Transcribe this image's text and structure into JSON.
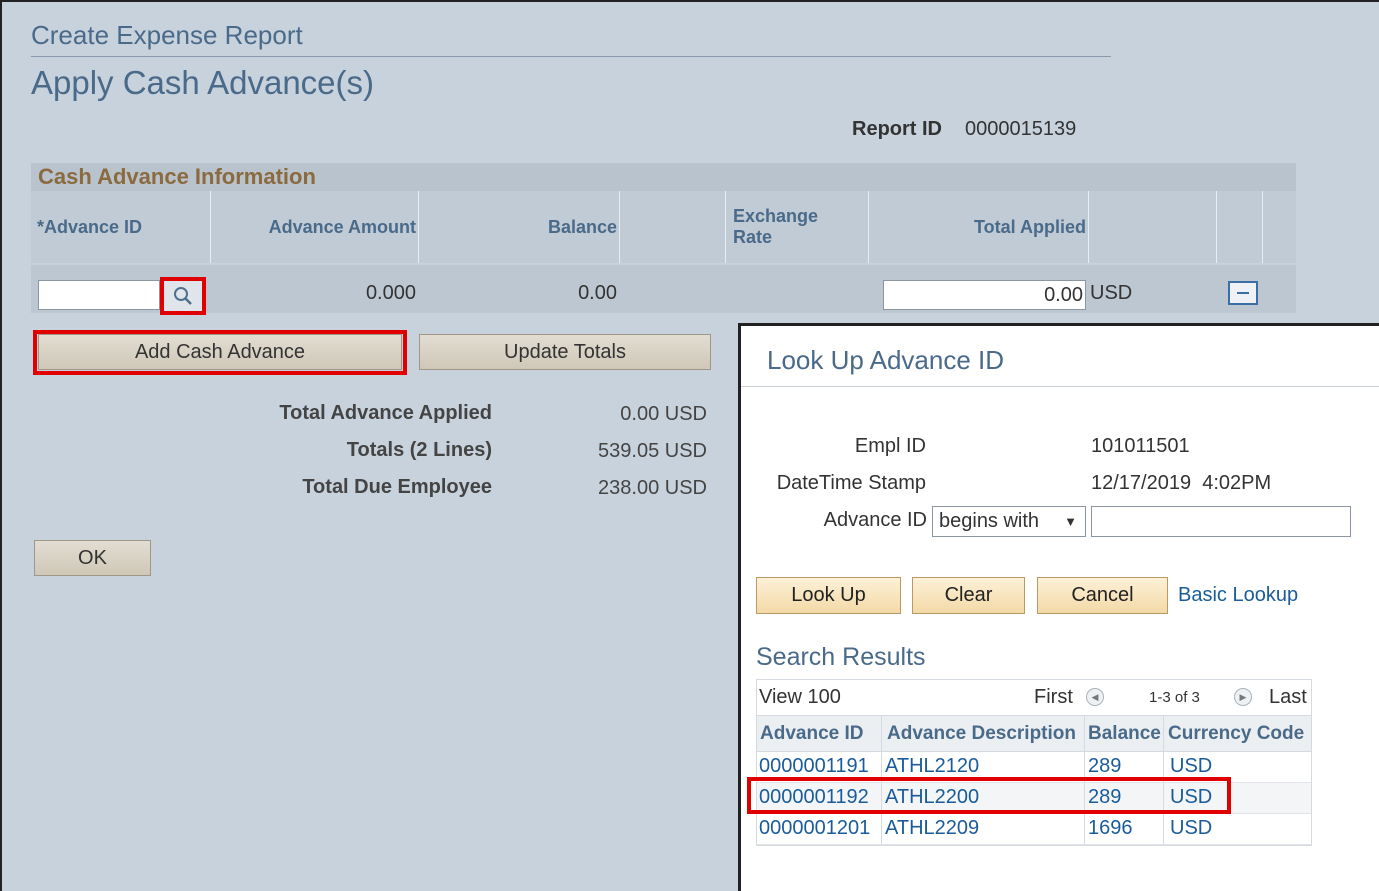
{
  "page": {
    "breadcrumb": "Create Expense Report",
    "heading": "Apply Cash Advance(s)",
    "report_id_label": "Report ID",
    "report_id_value": "0000015139"
  },
  "cash_advance": {
    "section_title": "Cash Advance Information",
    "columns": {
      "advance_id": "*Advance ID",
      "advance_amount": "Advance Amount",
      "balance": "Balance",
      "exchange_rate": "Exchange Rate",
      "total_applied": "Total Applied"
    },
    "row": {
      "advance_id": "",
      "advance_amount": "0.000",
      "balance": "0.00",
      "total_applied": "0.00",
      "currency": "USD"
    },
    "add_button": "Add Cash Advance",
    "update_button": "Update Totals"
  },
  "totals": {
    "applied_label": "Total Advance Applied",
    "applied_value": "0.00  USD",
    "lines_label": "Totals (2 Lines)",
    "lines_value": "539.05  USD",
    "due_label": "Total Due Employee",
    "due_value": "238.00  USD"
  },
  "ok_button": "OK",
  "lookup": {
    "title": "Look Up Advance ID",
    "empl_id_label": "Empl ID",
    "empl_id_value": "101011501",
    "datetime_label": "DateTime Stamp",
    "datetime_value": "12/17/2019  4:02PM",
    "advance_id_label": "Advance ID",
    "operator": "begins with",
    "advance_id_value": "",
    "buttons": {
      "lookup": "Look Up",
      "clear": "Clear",
      "cancel": "Cancel"
    },
    "basic_lookup_link": "Basic Lookup",
    "search_results_title": "Search Results",
    "nav": {
      "view": "View 100",
      "first": "First",
      "range": "1-3 of 3",
      "last": "Last"
    },
    "columns": [
      "Advance ID",
      "Advance Description",
      "Balance",
      "Currency Code"
    ],
    "rows": [
      {
        "id": "0000001191",
        "desc": "ATHL2120",
        "balance": "289",
        "currency": "USD"
      },
      {
        "id": "0000001192",
        "desc": "ATHL2200",
        "balance": "289",
        "currency": "USD"
      },
      {
        "id": "0000001201",
        "desc": "ATHL2209",
        "balance": "1696",
        "currency": "USD"
      }
    ]
  },
  "colors": {
    "highlight": "#e00000",
    "link": "#1a5c9a",
    "header_text": "#4a6a8a",
    "section_title": "#8b6a3e"
  }
}
